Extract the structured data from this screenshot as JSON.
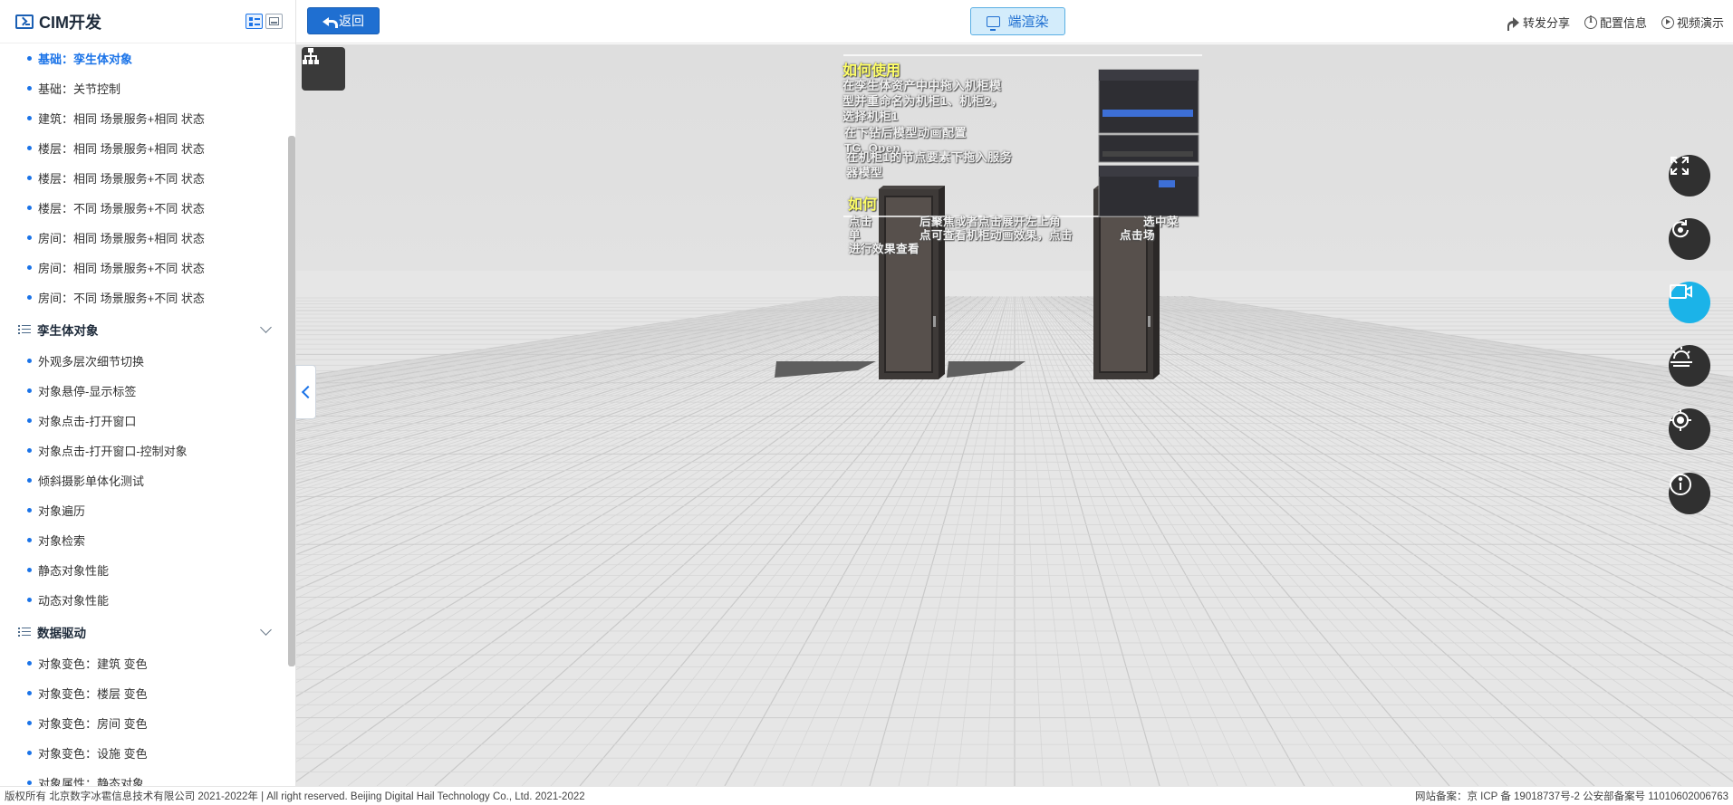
{
  "app": {
    "title": "CIM开发"
  },
  "sidebar": {
    "top_items": [
      {
        "label": "基础：孪生体对象",
        "active": true
      },
      {
        "label": "基础：关节控制"
      },
      {
        "label": "建筑：相同 场景服务+相同 状态"
      },
      {
        "label": "楼层：相同 场景服务+相同 状态"
      },
      {
        "label": "楼层：相同 场景服务+不同 状态"
      },
      {
        "label": "楼层：不同 场景服务+不同 状态"
      },
      {
        "label": "房间：相同 场景服务+相同 状态"
      },
      {
        "label": "房间：相同 场景服务+不同 状态"
      },
      {
        "label": "房间：不同 场景服务+不同 状态"
      }
    ],
    "groups": [
      {
        "title": "孪生体对象",
        "items": [
          {
            "label": "外观多层次细节切换"
          },
          {
            "label": "对象悬停-显示标签"
          },
          {
            "label": "对象点击-打开窗口"
          },
          {
            "label": "对象点击-打开窗口-控制对象"
          },
          {
            "label": "倾斜摄影单体化测试"
          },
          {
            "label": "对象遍历"
          },
          {
            "label": "对象检索"
          },
          {
            "label": "静态对象性能"
          },
          {
            "label": "动态对象性能"
          }
        ]
      },
      {
        "title": "数据驱动",
        "items": [
          {
            "label": "对象变色：建筑 变色"
          },
          {
            "label": "对象变色：楼层 变色"
          },
          {
            "label": "对象变色：房间 变色"
          },
          {
            "label": "对象变色：设施 变色"
          },
          {
            "label": "对象属性：静态对象"
          }
        ]
      }
    ]
  },
  "topbar": {
    "back_label": "返回",
    "render_label": "端渲染",
    "links": [
      {
        "label": "转发分享",
        "icon": "share-icon"
      },
      {
        "label": "配置信息",
        "icon": "info-icon"
      },
      {
        "label": "视频演示",
        "icon": "play-icon"
      }
    ]
  },
  "scene": {
    "heading1": "如何使用",
    "steps": [
      "在孪生体资产中中拖入机柜模型并重命名为机柜1、机柜2，选择机柜1",
      "在下钻后模型动画配置TG_Open",
      "在机柜1的节点要素下拖入服务器模型"
    ],
    "heading2": "如何",
    "desc2": "点击　　　　后聚焦或者点击展开左上角　　　　　　　选中菜单　　　　　点可查看机柜动画效果，点击　　　　点击场　　　　　进行效果查看"
  },
  "right_tools": [
    {
      "name": "fullscreen-button",
      "icon": "expand-icon"
    },
    {
      "name": "rotate-button",
      "icon": "rotate-icon"
    },
    {
      "name": "record-button",
      "icon": "camera-icon",
      "active": true
    },
    {
      "name": "weather-button",
      "icon": "weather-icon"
    },
    {
      "name": "locate-button",
      "icon": "target-icon"
    },
    {
      "name": "info-button",
      "icon": "info-icon"
    }
  ],
  "footer": {
    "copyright": "版权所有 北京数字冰雹信息技术有限公司 2021-2022年 | All right reserved. Beijing Digital Hail Technology Co., Ltd. 2021-2022",
    "icp": "网站备案：京 ICP 备 19018737号-2 公安部备案号 11010602006763"
  }
}
